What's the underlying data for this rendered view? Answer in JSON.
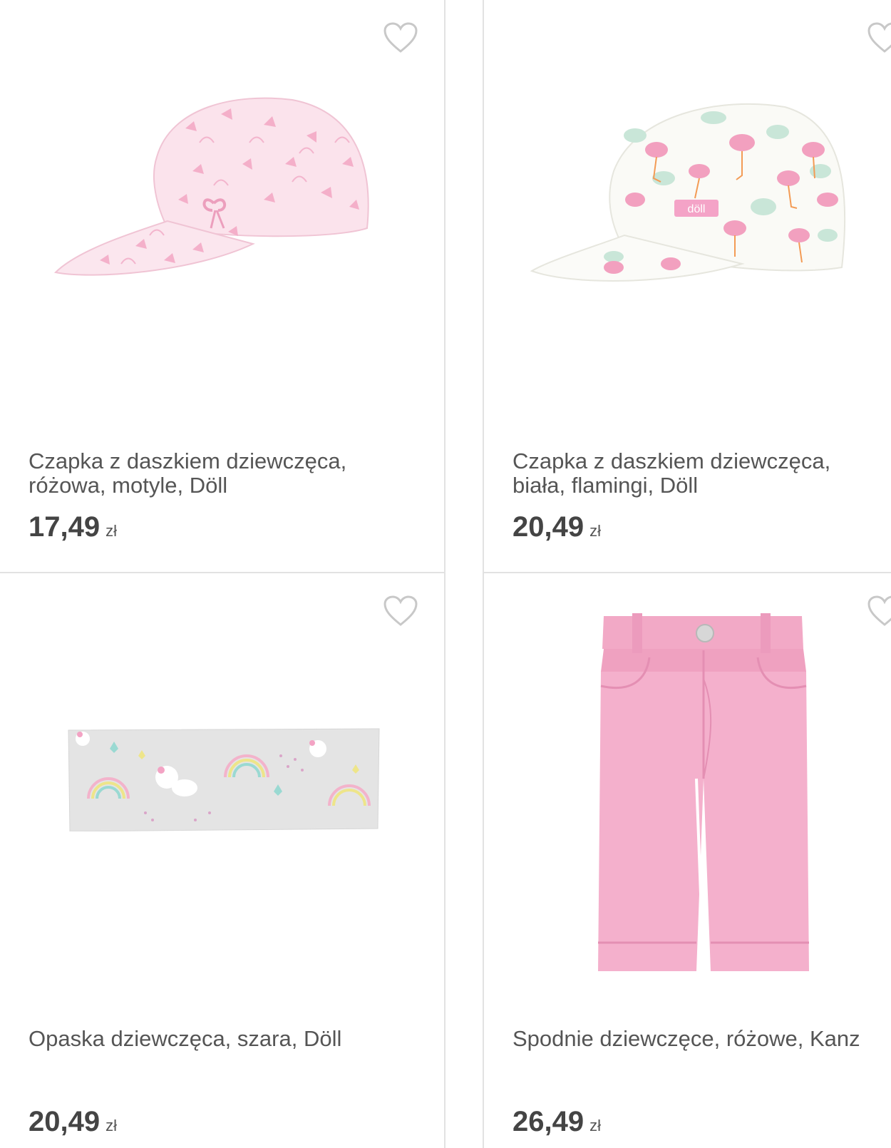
{
  "products": [
    {
      "name": "Czapka z daszkiem dziewczęca,\nróżowa, motyle, Döll",
      "price": "17,49",
      "currency": "zł",
      "image": "pink-butterfly-cap",
      "icon": "heart-outline-icon"
    },
    {
      "name": "Czapka z daszkiem dziewczęca,\nbiała, flamingi, Döll",
      "price": "20,49",
      "currency": "zł",
      "image": "white-flamingo-cap",
      "icon": "heart-outline-icon"
    },
    {
      "name": "Opaska dziewczęca, szara, Döll",
      "price": "20,49",
      "currency": "zł",
      "image": "grey-unicorn-headband",
      "icon": "heart-outline-icon"
    },
    {
      "name": "Spodnie dziewczęce, różowe, Kanz",
      "price": "26,49",
      "currency": "zł",
      "image": "pink-trousers",
      "icon": "heart-outline-icon"
    }
  ],
  "colors": {
    "border": "#e2e2e2",
    "text": "#555555",
    "price": "#444444",
    "heart": "#c8c8c8",
    "pink": "#f2a9c6",
    "pink_light": "#f9dbe6"
  }
}
